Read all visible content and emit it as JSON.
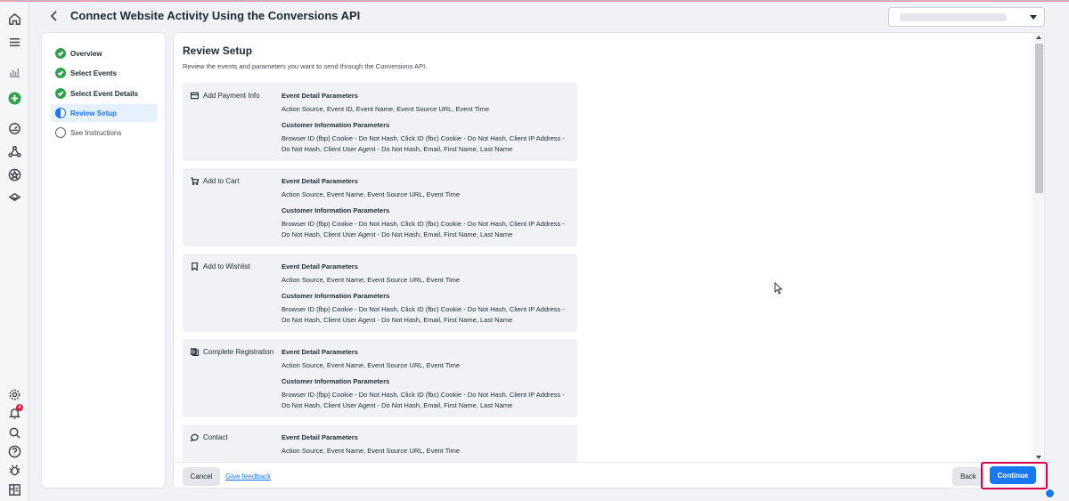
{
  "header": {
    "title": "Connect Website Activity Using the Conversions API"
  },
  "rail": {
    "icons": [
      "home-icon",
      "menu-icon",
      "chart-icon",
      "create-icon",
      "gauge-icon",
      "network-icon",
      "star-icon",
      "catalog-icon",
      "settings-icon",
      "notifications-icon",
      "search-icon",
      "help-icon",
      "bug-icon",
      "panel-icon"
    ],
    "notification_badge": "4"
  },
  "steps": [
    {
      "label": "Overview",
      "state": "done"
    },
    {
      "label": "Select Events",
      "state": "done"
    },
    {
      "label": "Select Event Details",
      "state": "done"
    },
    {
      "label": "Review Setup",
      "state": "active"
    },
    {
      "label": "See Instructions",
      "state": "todo"
    }
  ],
  "main": {
    "title": "Review Setup",
    "subtitle": "Review the events and parameters you want to send through the Conversions API.",
    "cards": [
      {
        "event": "Add Payment Info",
        "icon": "credit-card-icon",
        "detail_heading": "Event Detail Parameters",
        "detail_text": "Action Source, Event ID, Event Name, Event Source URL, Event Time",
        "customer_heading": "Customer Information Parameters",
        "customer_text": "Browser ID (fbp) Cookie - Do Not Hash, Click ID (fbc) Cookie - Do Not Hash, Client IP Address - Do Not Hash, Client User Agent - Do Not Hash, Email, First Name, Last Name"
      },
      {
        "event": "Add to Cart",
        "icon": "cart-icon",
        "detail_heading": "Event Detail Parameters",
        "detail_text": "Action Source, Event Name, Event Source URL, Event Time",
        "customer_heading": "Customer Information Parameters",
        "customer_text": "Browser ID (fbp) Cookie - Do Not Hash, Click ID (fbc) Cookie - Do Not Hash, Client IP Address - Do Not Hash, Client User Agent - Do Not Hash, Email, First Name, Last Name"
      },
      {
        "event": "Add to Wishlist",
        "icon": "bookmark-icon",
        "detail_heading": "Event Detail Parameters",
        "detail_text": "Action Source, Event Name, Event Source URL, Event Time",
        "customer_heading": "Customer Information Parameters",
        "customer_text": "Browser ID (fbp) Cookie - Do Not Hash, Click ID (fbc) Cookie - Do Not Hash, Client IP Address - Do Not Hash, Client User Agent - Do Not Hash, Email, First Name, Last Name"
      },
      {
        "event": "Complete Registration",
        "icon": "registration-icon",
        "detail_heading": "Event Detail Parameters",
        "detail_text": "Action Source, Event Name, Event Source URL, Event Time",
        "customer_heading": "Customer Information Parameters",
        "customer_text": "Browser ID (fbp) Cookie - Do Not Hash, Click ID (fbc) Cookie - Do Not Hash, Client IP Address - Do Not Hash, Client User Agent - Do Not Hash, Email, First Name, Last Name"
      },
      {
        "event": "Contact",
        "icon": "chat-bubble-icon",
        "detail_heading": "Event Detail Parameters",
        "detail_text": "Action Source, Event Name, Event Source URL, Event Time",
        "customer_heading": "",
        "customer_text": ""
      }
    ]
  },
  "footer": {
    "cancel_label": "Cancel",
    "feedback_label": "Give feedback",
    "back_label": "Back",
    "continue_label": "Continue"
  },
  "colors": {
    "accent": "#1877f2",
    "success": "#31a24c",
    "highlight_box": "#d6004f"
  }
}
